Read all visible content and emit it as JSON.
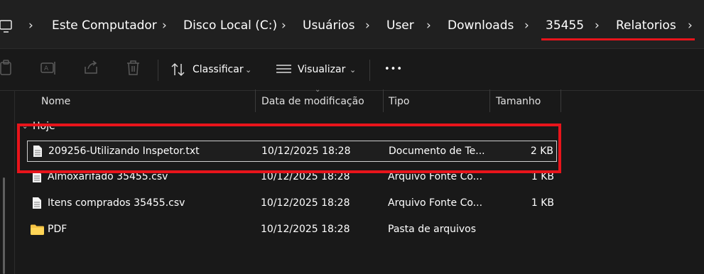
{
  "breadcrumb": {
    "items": [
      "Este Computador",
      "Disco Local (C:)",
      "Usuários",
      "User",
      "Downloads",
      "35455",
      "Relatorios"
    ]
  },
  "toolbar": {
    "sort_label": "Classificar",
    "view_label": "Visualizar",
    "more_label": "•••"
  },
  "columns": {
    "name": "Nome",
    "date": "Data de modificação",
    "type": "Tipo",
    "size": "Tamanho"
  },
  "group": {
    "label": "Hoje"
  },
  "files": [
    {
      "name": "209256-Utilizando Inspetor.txt",
      "date": "10/12/2025 18:28",
      "type": "Documento de Te...",
      "size": "2 KB",
      "icon": "text-file-icon"
    },
    {
      "name": "Almoxarifado 35455.csv",
      "date": "10/12/2025 18:28",
      "type": "Arquivo Fonte Co...",
      "size": "1 KB",
      "icon": "text-file-icon"
    },
    {
      "name": "Itens comprados 35455.csv",
      "date": "10/12/2025 18:28",
      "type": "Arquivo Fonte Co...",
      "size": "1 KB",
      "icon": "text-file-icon"
    },
    {
      "name": "PDF",
      "date": "10/12/2025 18:28",
      "type": "Pasta de arquivos",
      "size": "",
      "icon": "folder-icon"
    }
  ],
  "colors": {
    "annotation_red": "#e8141b",
    "folder_yellow": "#f4c243",
    "background": "#191919"
  }
}
